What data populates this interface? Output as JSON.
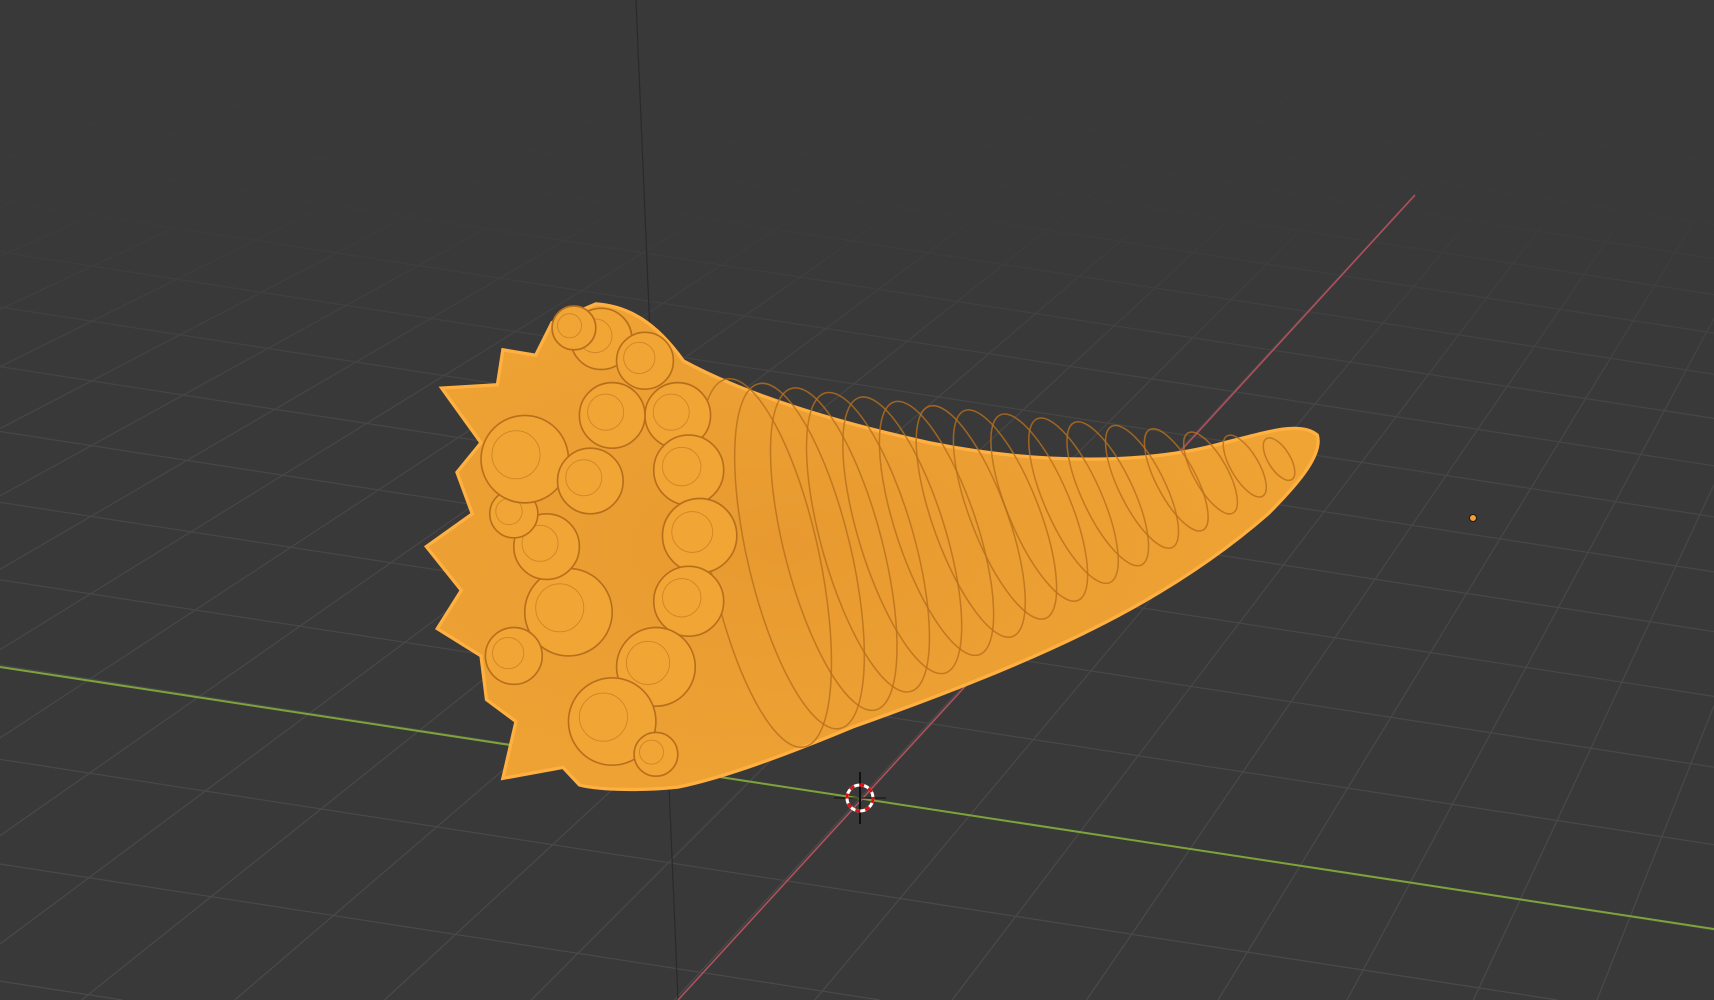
{
  "viewport": {
    "view": "3d-viewport",
    "colors": {
      "background": "#393939",
      "grid": "#4a4a4a",
      "x_axis": "#b0505e",
      "y_axis": "#7ea33a",
      "selection": "#f5a030",
      "selection_outline": "#ffb040",
      "mesh_wire": "#b86f1c"
    },
    "icons": {
      "cursor": "3d-cursor-icon",
      "light": "light-object-icon"
    }
  }
}
